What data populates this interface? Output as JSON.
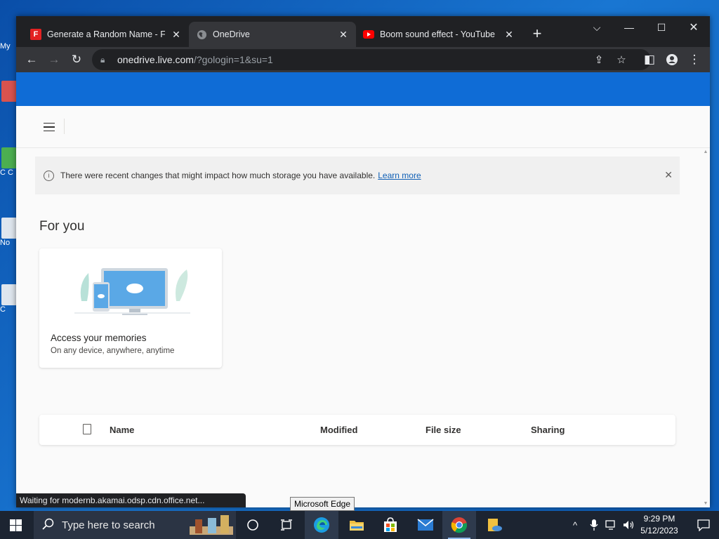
{
  "desktop": {
    "icons": [
      {
        "label": "My"
      },
      {
        "label": ""
      },
      {
        "label": "C C"
      },
      {
        "label": "No"
      },
      {
        "label": "C"
      }
    ]
  },
  "browser": {
    "tabs": [
      {
        "title": "Generate a Random Name - Fak",
        "favicon": "F",
        "favicon_color": "#e32222"
      },
      {
        "title": "OneDrive",
        "favicon": "globe-icon",
        "active": true
      },
      {
        "title": "Boom sound effect - YouTube",
        "favicon": "youtube-icon",
        "favicon_color": "#ff0000"
      }
    ],
    "address": {
      "host": "onedrive.live.com",
      "path": "/?gologin=1&su=1"
    },
    "status_text": "Waiting for modernb.akamai.odsp.cdn.office.net..."
  },
  "page": {
    "header_color": "#0f6cd6",
    "notice": {
      "text": "There were recent changes that might impact how much storage you have available.",
      "link": "Learn more"
    },
    "section_title": "For you",
    "card": {
      "title": "Access your memories",
      "subtitle": "On any device, anywhere, anytime"
    },
    "list_columns": [
      "Name",
      "Modified",
      "File size",
      "Sharing"
    ]
  },
  "tooltip": "Microsoft Edge",
  "taskbar": {
    "search_placeholder": "Type here to search",
    "time": "9:29 PM",
    "date": "5/12/2023"
  }
}
